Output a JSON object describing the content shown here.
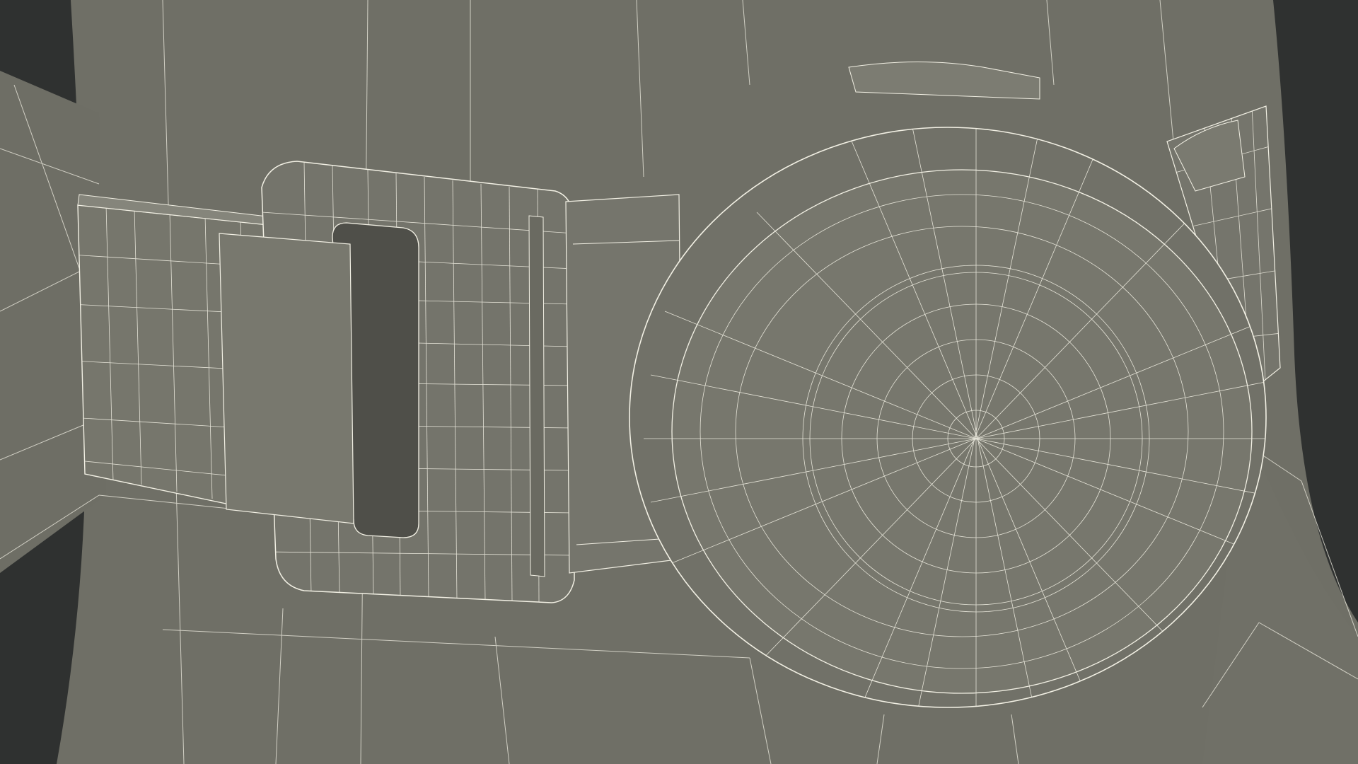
{
  "scene": {
    "subject": "belt-with-round-buckle-wireframe",
    "colors": {
      "background": "#2f3130",
      "surface": "#76766c",
      "surface_dark": "#6a6a61",
      "surface_light": "#83837a",
      "shadow": "#4f4f49",
      "wire": "#f2f0e4"
    }
  }
}
